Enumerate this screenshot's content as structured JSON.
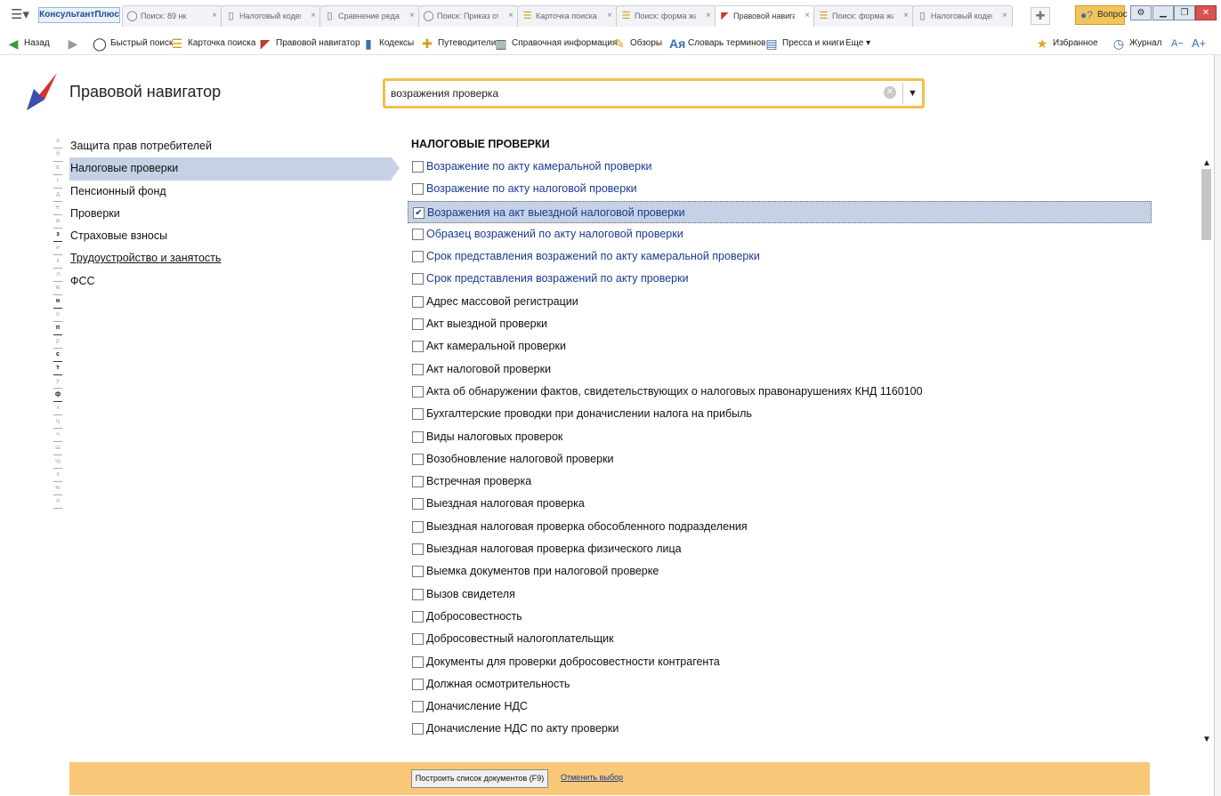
{
  "tabbar": {
    "brand": "КонсультантПлюс",
    "tabs": [
      {
        "label": "Поиск: 89 нк",
        "icon": "search-icon"
      },
      {
        "label": "Налоговый кодекс",
        "icon": "document-icon"
      },
      {
        "label": "Сравнение редакций",
        "icon": "document-icon"
      },
      {
        "label": "Поиск: Приказ от",
        "icon": "search-icon"
      },
      {
        "label": "Карточка поиска",
        "icon": "search-card-icon"
      },
      {
        "label": "Поиск: форма жалобы",
        "icon": "search-card-icon"
      },
      {
        "label": "Правовой навигатор",
        "icon": "navigator-icon",
        "active": true
      },
      {
        "label": "Поиск: форма жалобы",
        "icon": "search-card-icon"
      },
      {
        "label": "Налоговый кодекс",
        "icon": "document-icon"
      }
    ],
    "question_label": "Вопрос"
  },
  "toolbar": {
    "back": "Назад",
    "quick_search": "Быстрый поиск",
    "search_card": "Карточка поиска",
    "navigator": "Правовой навигатор",
    "codes": "Кодексы",
    "guides": "Путеводители",
    "reference": "Справочная информация",
    "reviews": "Обзоры",
    "dictionary": "Словарь терминов",
    "press": "Пресса и книги",
    "more": "Еще",
    "favorites": "Избранное",
    "journal": "Журнал",
    "font_minus": "A−",
    "font_plus": "A+"
  },
  "header": {
    "title": "Правовой навигатор",
    "search_value": "возражения проверка"
  },
  "alphabet": [
    {
      "l": "а",
      "on": false
    },
    {
      "l": "б",
      "on": false
    },
    {
      "l": "в",
      "on": false
    },
    {
      "l": "г",
      "on": false
    },
    {
      "l": "д",
      "on": false
    },
    {
      "l": "е",
      "on": false
    },
    {
      "l": "ж",
      "on": false
    },
    {
      "l": "з",
      "on": true
    },
    {
      "l": "и",
      "on": false
    },
    {
      "l": "к",
      "on": false
    },
    {
      "l": "л",
      "on": false
    },
    {
      "l": "м",
      "on": false
    },
    {
      "l": "н",
      "on": true
    },
    {
      "l": "о",
      "on": false
    },
    {
      "l": "п",
      "on": true
    },
    {
      "l": "р",
      "on": false
    },
    {
      "l": "с",
      "on": true
    },
    {
      "l": "т",
      "on": true
    },
    {
      "l": "у",
      "on": false
    },
    {
      "l": "ф",
      "on": true
    },
    {
      "l": "х",
      "on": false
    },
    {
      "l": "ц",
      "on": false
    },
    {
      "l": "ч",
      "on": false
    },
    {
      "l": "ш",
      "on": false
    },
    {
      "l": "щ",
      "on": false
    },
    {
      "l": "э",
      "on": false
    },
    {
      "l": "ю",
      "on": false
    },
    {
      "l": "я",
      "on": false
    }
  ],
  "categories": [
    {
      "label": "Защита прав потребителей"
    },
    {
      "label": "Налоговые проверки",
      "selected": true
    },
    {
      "label": "Пенсионный фонд"
    },
    {
      "label": "Проверки"
    },
    {
      "label": "Страховые взносы"
    },
    {
      "label": "Трудоустройство и занятость",
      "underline": true
    },
    {
      "label": "ФСС"
    }
  ],
  "list": {
    "header": "НАЛОГОВЫЕ ПРОВЕРКИ",
    "items": [
      {
        "label": "Возражение по акту камеральной проверки",
        "link": true
      },
      {
        "label": "Возражение по акту налоговой проверки",
        "link": true
      },
      {
        "label": "Возражения на акт выездной налоговой проверки",
        "link": true,
        "checked": true,
        "selected": true
      },
      {
        "label": "Образец возражений по акту налоговой проверки",
        "link": true
      },
      {
        "label": "Срок представления возражений по акту камеральной проверки",
        "link": true
      },
      {
        "label": "Срок представления возражений по акту проверки",
        "link": true
      },
      {
        "label": "Адрес массовой регистрации"
      },
      {
        "label": "Акт выездной проверки"
      },
      {
        "label": "Акт камеральной проверки"
      },
      {
        "label": "Акт налоговой проверки"
      },
      {
        "label": "Акта об обнаружении фактов, свидетельствующих о налоговых правонарушениях КНД 1160100"
      },
      {
        "label": "Бухгалтерские проводки при доначислении налога на прибыль"
      },
      {
        "label": "Виды налоговых проверок"
      },
      {
        "label": "Возобновление налоговой проверки"
      },
      {
        "label": "Встречная проверка"
      },
      {
        "label": "Выездная налоговая проверка"
      },
      {
        "label": "Выездная налоговая проверка обособленного подразделения"
      },
      {
        "label": "Выездная налоговая проверка физического лица"
      },
      {
        "label": "Выемка документов при налоговой проверке"
      },
      {
        "label": "Вызов свидетеля"
      },
      {
        "label": "Добросовестность"
      },
      {
        "label": "Добросовестный налогоплательщик"
      },
      {
        "label": "Документы для проверки добросовестности контрагента"
      },
      {
        "label": "Должная осмотрительность"
      },
      {
        "label": "Доначисление НДС"
      },
      {
        "label": "Доначисление НДС по акту проверки"
      }
    ]
  },
  "footer": {
    "build_label": "Построить список документов (F9)",
    "cancel_label": "Отменить выбор"
  }
}
